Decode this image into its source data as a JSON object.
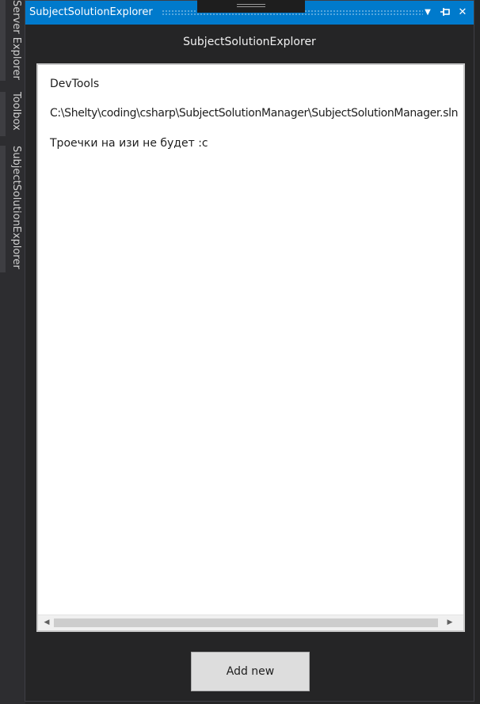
{
  "side_tabs": [
    {
      "label": "Server Explorer"
    },
    {
      "label": "Toolbox"
    },
    {
      "label": "SubjectSolutionExplorer"
    }
  ],
  "tool_window": {
    "title": "SubjectSolutionExplorer",
    "buttons": {
      "dropdown_glyph": "▼",
      "pin_glyph": "⊣",
      "close_glyph": "✕"
    }
  },
  "panel": {
    "heading": "SubjectSolutionExplorer",
    "items": [
      {
        "text": "DevTools"
      },
      {
        "text": "C:\\Shelty\\coding\\csharp\\SubjectSolutionManager\\SubjectSolutionManager.sln"
      },
      {
        "text": "Троечки на изи не будет :с"
      }
    ],
    "scrollbar": {
      "left_arrow": "◀",
      "right_arrow": "▶"
    }
  },
  "actions": {
    "add_new_label": "Add new"
  },
  "colors": {
    "accent": "#007acc",
    "background": "#252526",
    "list_background": "#ffffff",
    "button_background": "#dddddd"
  }
}
